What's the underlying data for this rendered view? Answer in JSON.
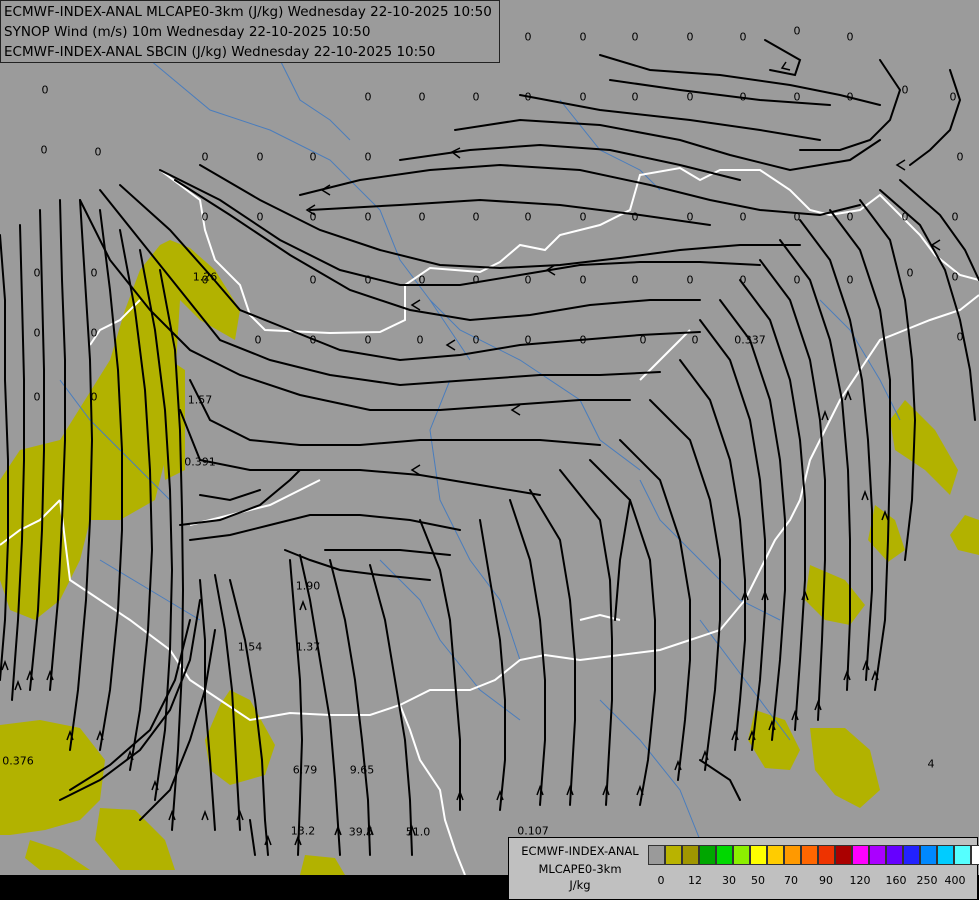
{
  "header": {
    "lines": [
      "ECMWF-INDEX-ANAL MLCAPE0-3km (J/kg) Wednesday 22-10-2025 10:50",
      "SYNOP Wind (m/s) 10m Wednesday 22-10-2025 10:50",
      "ECMWF-INDEX-ANAL SBCIN (J/kg) Wednesday 22-10-2025 10:50"
    ]
  },
  "legend": {
    "title_lines": [
      "ECMWF-INDEX-ANAL",
      "MLCAPE0-3km",
      "J/kg"
    ],
    "colors": [
      "#9a9a9a",
      "#b9b300",
      "#a09600",
      "#00a600",
      "#00d800",
      "#8cf000",
      "#ffff00",
      "#ffcc00",
      "#ff9900",
      "#ff6600",
      "#ee3300",
      "#aa0000",
      "#ff00ff",
      "#aa00ff",
      "#6600ff",
      "#2222ff",
      "#0088ff",
      "#00ccff",
      "#55ffff",
      "#ffffff"
    ],
    "ticks": [
      "0",
      "12",
      "30",
      "50",
      "70",
      "90",
      "120",
      "160",
      "250",
      "400"
    ]
  },
  "colors": {
    "background": "#9b9b9b",
    "cape_fill": "#b2b200",
    "borders": "#ffffff",
    "rivers": "#4a7dbd",
    "streamlines": "#000000"
  },
  "field_values": [
    {
      "text": "0"
    },
    {
      "text": "0"
    },
    {
      "text": "0"
    },
    {
      "text": "0"
    },
    {
      "text": "0"
    },
    {
      "text": "0"
    },
    {
      "text": "0"
    },
    {
      "text": "0"
    },
    {
      "text": "0"
    },
    {
      "text": "0"
    },
    {
      "text": "0"
    },
    {
      "text": "0"
    },
    {
      "text": "0"
    },
    {
      "text": "0"
    },
    {
      "text": "0"
    },
    {
      "text": "0"
    },
    {
      "text": "0"
    },
    {
      "text": "0"
    },
    {
      "text": "0"
    },
    {
      "text": "0"
    },
    {
      "text": "0"
    },
    {
      "text": "0"
    },
    {
      "text": "0"
    },
    {
      "text": "0"
    },
    {
      "text": "0"
    },
    {
      "text": "0"
    },
    {
      "text": "0"
    },
    {
      "text": "0"
    },
    {
      "text": "0"
    },
    {
      "text": "0"
    },
    {
      "text": "0"
    },
    {
      "text": "0"
    },
    {
      "text": "0"
    },
    {
      "text": "0"
    },
    {
      "text": "0"
    },
    {
      "text": "0"
    },
    {
      "text": "0"
    },
    {
      "text": "0"
    },
    {
      "text": "0"
    },
    {
      "text": "0"
    },
    {
      "text": "0"
    },
    {
      "text": "0"
    },
    {
      "text": "0"
    },
    {
      "text": "0"
    },
    {
      "text": "0"
    },
    {
      "text": "0"
    },
    {
      "text": "0"
    },
    {
      "text": "0"
    },
    {
      "text": "0"
    },
    {
      "text": "0"
    },
    {
      "text": "0"
    },
    {
      "text": "0"
    },
    {
      "text": "0"
    },
    {
      "text": "0"
    },
    {
      "text": "0"
    },
    {
      "text": "0"
    },
    {
      "text": "0"
    },
    {
      "text": "0"
    },
    {
      "text": "0"
    },
    {
      "text": "0"
    },
    {
      "text": "0"
    },
    {
      "text": "0"
    },
    {
      "text": "0"
    },
    {
      "text": "0"
    },
    {
      "text": "0"
    },
    {
      "text": "0"
    },
    {
      "text": "0"
    },
    {
      "text": "0"
    },
    {
      "text": "0"
    },
    {
      "text": "0"
    },
    {
      "text": "0"
    },
    {
      "text": "0"
    },
    {
      "text": "0.337"
    },
    {
      "text": "1.26"
    },
    {
      "text": "1.57"
    },
    {
      "text": "0.391"
    },
    {
      "text": "1.90"
    },
    {
      "text": "1.54"
    },
    {
      "text": "1.37"
    },
    {
      "text": "6.79"
    },
    {
      "text": "9.65"
    },
    {
      "text": "13.2"
    },
    {
      "text": "39.5"
    },
    {
      "text": "51.0"
    },
    {
      "text": "0.107"
    },
    {
      "text": "0.376"
    },
    {
      "text": "4"
    }
  ]
}
